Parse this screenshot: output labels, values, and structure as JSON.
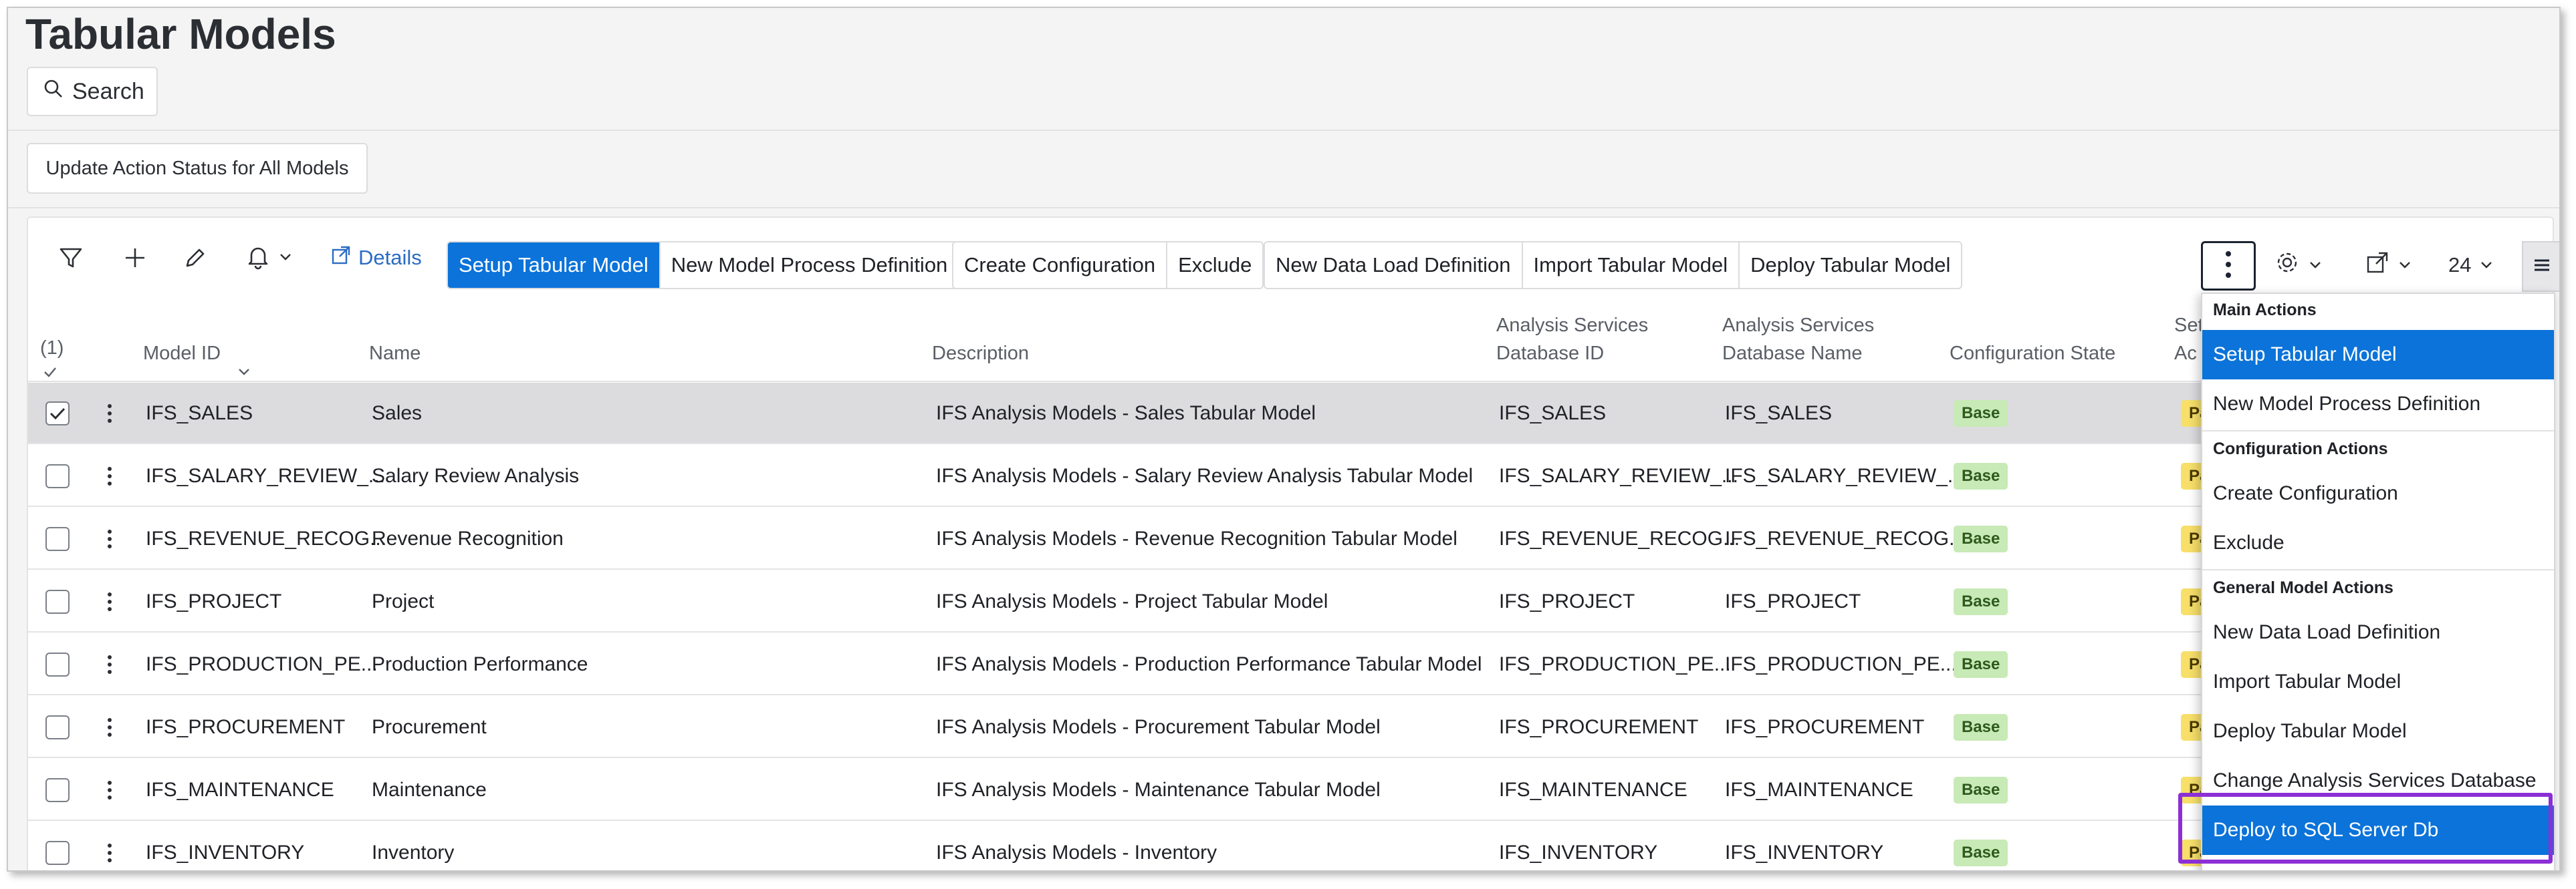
{
  "page": {
    "title": "Tabular Models"
  },
  "search": {
    "label": "Search"
  },
  "update_all": {
    "label": "Update Action Status for All Models"
  },
  "toolbar": {
    "details_label": "Details",
    "group1": [
      "Setup Tabular Model",
      "New Model Process Definition"
    ],
    "group2": [
      "Create Configuration",
      "Exclude"
    ],
    "group3": [
      "New Data Load Definition",
      "Import Tabular Model",
      "Deploy Tabular Model"
    ],
    "page_size": "24"
  },
  "table": {
    "selected_count": "(1)",
    "columns": {
      "model_id": "Model ID",
      "name": "Name",
      "description": "Description",
      "as_db_id_1": "Analysis Services",
      "as_db_id_2": "Database ID",
      "as_db_name_1": "Analysis Services",
      "as_db_name_2": "Database Name",
      "config_state": "Configuration State",
      "setup_partial_1": "Set",
      "setup_partial_2": "Ac"
    },
    "rows": [
      {
        "model_id": "IFS_SALES",
        "name": "Sales",
        "description": "IFS Analysis Models - Sales Tabular Model",
        "db_id": "IFS_SALES",
        "db_name": "IFS_SALES",
        "config": "Base",
        "status_partial": "Pa",
        "selected": true
      },
      {
        "model_id": "IFS_SALARY_REVIEW_...",
        "name": "Salary Review Analysis",
        "description": "IFS Analysis Models - Salary Review Analysis Tabular Model",
        "db_id": "IFS_SALARY_REVIEW_...",
        "db_name": "IFS_SALARY_REVIEW_...",
        "config": "Base",
        "status_partial": "Pa"
      },
      {
        "model_id": "IFS_REVENUE_RECOG...",
        "name": "Revenue Recognition",
        "description": "IFS Analysis Models - Revenue Recognition Tabular Model",
        "db_id": "IFS_REVENUE_RECOG...",
        "db_name": "IFS_REVENUE_RECOG...",
        "config": "Base",
        "status_partial": "Pa"
      },
      {
        "model_id": "IFS_PROJECT",
        "name": "Project",
        "description": "IFS Analysis Models - Project Tabular Model",
        "db_id": "IFS_PROJECT",
        "db_name": "IFS_PROJECT",
        "config": "Base",
        "status_partial": "Pa"
      },
      {
        "model_id": "IFS_PRODUCTION_PE...",
        "name": "Production Performance",
        "description": "IFS Analysis Models - Production Performance Tabular Model",
        "db_id": "IFS_PRODUCTION_PE...",
        "db_name": "IFS_PRODUCTION_PE...",
        "config": "Base",
        "status_partial": "Pa"
      },
      {
        "model_id": "IFS_PROCUREMENT",
        "name": "Procurement",
        "description": "IFS Analysis Models - Procurement Tabular Model",
        "db_id": "IFS_PROCUREMENT",
        "db_name": "IFS_PROCUREMENT",
        "config": "Base",
        "status_partial": "Pa"
      },
      {
        "model_id": "IFS_MAINTENANCE",
        "name": "Maintenance",
        "description": "IFS Analysis Models - Maintenance Tabular Model",
        "db_id": "IFS_MAINTENANCE",
        "db_name": "IFS_MAINTENANCE",
        "config": "Base",
        "status_partial": "Pa"
      },
      {
        "model_id": "IFS_INVENTORY",
        "name": "Inventory",
        "description": "IFS Analysis Models - Inventory",
        "db_id": "IFS_INVENTORY",
        "db_name": "IFS_INVENTORY",
        "config": "Base",
        "status_partial": "Pa"
      }
    ]
  },
  "menu": {
    "main_actions": "Main Actions",
    "setup_tabular_model": "Setup Tabular Model",
    "new_model_process_definition": "New Model Process Definition",
    "configuration_actions": "Configuration Actions",
    "create_configuration": "Create Configuration",
    "exclude": "Exclude",
    "general_model_actions": "General Model Actions",
    "new_data_load_definition": "New Data Load Definition",
    "import_tabular_model": "Import Tabular Model",
    "deploy_tabular_model": "Deploy Tabular Model",
    "change_as_database": "Change Analysis Services Database",
    "deploy_sql_server": "Deploy to SQL Server Db"
  },
  "colors": {
    "primary": "#0b73d9",
    "highlight": "#8c2fd6",
    "badge_base": "#c8eab6",
    "badge_status": "#f7df6a"
  }
}
